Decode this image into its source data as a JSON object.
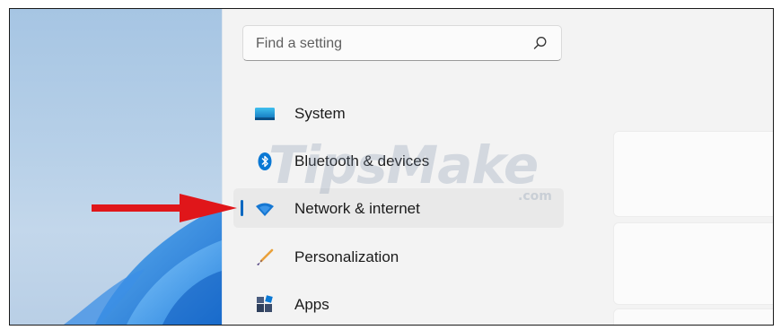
{
  "search": {
    "placeholder": "Find a setting",
    "icon": "search-icon"
  },
  "nav": {
    "items": [
      {
        "label": "System",
        "icon": "display-icon",
        "selected": false
      },
      {
        "label": "Bluetooth & devices",
        "icon": "bluetooth-icon",
        "selected": false
      },
      {
        "label": "Network & internet",
        "icon": "wifi-icon",
        "selected": true
      },
      {
        "label": "Personalization",
        "icon": "brush-icon",
        "selected": false
      },
      {
        "label": "Apps",
        "icon": "apps-icon",
        "selected": false
      }
    ]
  },
  "watermark": {
    "brand": "TipsMake",
    "suffix": ".com"
  },
  "colors": {
    "accent": "#0067c0",
    "arrow": "#e0161a",
    "background": "#f3f3f3"
  }
}
